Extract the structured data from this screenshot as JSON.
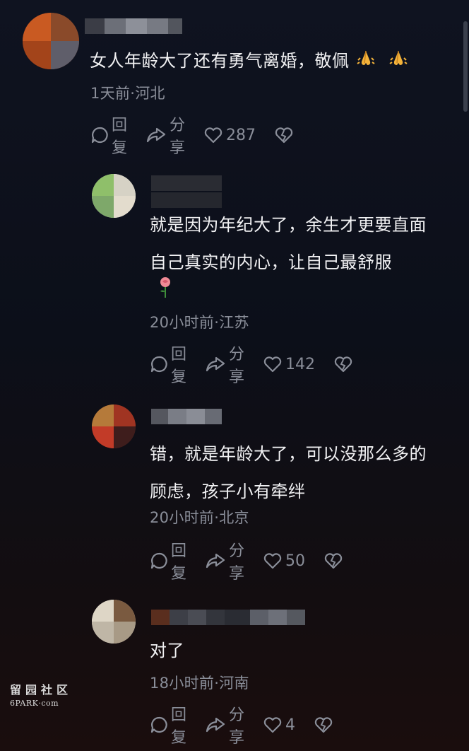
{
  "comments": [
    {
      "text_lines": [
        "女人年龄大了还有勇气离婚，敬佩"
      ],
      "emoji_after": [
        "praying-hands-emoji",
        "praying-hands-emoji"
      ],
      "meta": "1天前·河北",
      "actions": {
        "reply": "回复",
        "share": "分享",
        "likes": "287"
      }
    },
    {
      "text_lines": [
        "就是因为年纪大了，余生才更要直面",
        "自己真实的内心，让自己最舒服"
      ],
      "emoji_line": "rose-emoji",
      "meta": "20小时前·江苏",
      "actions": {
        "reply": "回复",
        "share": "分享",
        "likes": "142"
      }
    },
    {
      "text_lines": [
        "错，就是年龄大了，可以没那么多的",
        "顾虑，孩子小有牵绊"
      ],
      "meta": "20小时前·北京",
      "actions": {
        "reply": "回复",
        "share": "分享",
        "likes": "50"
      }
    },
    {
      "text_lines": [
        "对了"
      ],
      "meta": "18小时前·河南",
      "actions": {
        "reply": "回复",
        "share": "分享",
        "likes": "4"
      }
    }
  ],
  "watermark": {
    "cn": "留园社区",
    "en": "6PARK·com"
  },
  "colors": {
    "background": "#0e111b",
    "text": "#f2f2f4",
    "meta": "#8a8e99"
  }
}
